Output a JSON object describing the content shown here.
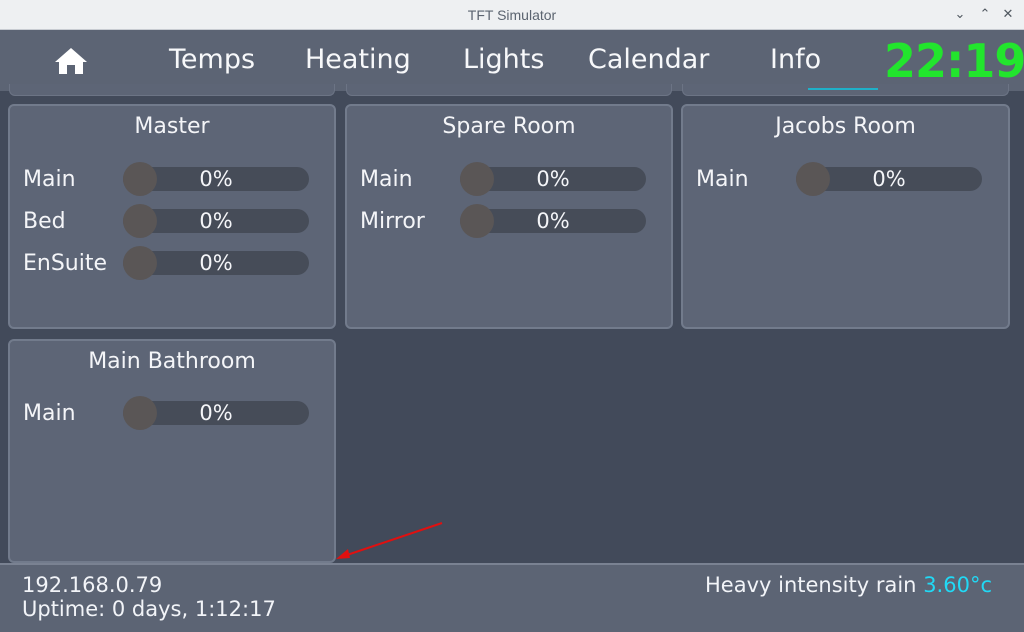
{
  "window": {
    "title": "TFT Simulator"
  },
  "nav": {
    "tabs": [
      {
        "label": "Temps"
      },
      {
        "label": "Heating"
      },
      {
        "label": "Lights"
      },
      {
        "label": "Calendar"
      },
      {
        "label": "Info"
      }
    ],
    "active_tab": "Lights",
    "clock": "22:19"
  },
  "cards": [
    {
      "title": "Master",
      "lights": [
        {
          "label": "Main",
          "value": "0%",
          "level": 0
        },
        {
          "label": "Bed",
          "value": "0%",
          "level": 0
        },
        {
          "label": "EnSuite",
          "value": "0%",
          "level": 0
        }
      ]
    },
    {
      "title": "Spare Room",
      "lights": [
        {
          "label": "Main",
          "value": "0%",
          "level": 0
        },
        {
          "label": "Mirror",
          "value": "0%",
          "level": 0
        }
      ]
    },
    {
      "title": "Jacobs Room",
      "lights": [
        {
          "label": "Main",
          "value": "0%",
          "level": 0
        }
      ]
    },
    {
      "title": "Main Bathroom",
      "lights": [
        {
          "label": "Main",
          "value": "0%",
          "level": 0
        }
      ]
    }
  ],
  "status": {
    "ip": "192.168.0.79",
    "uptime": "Uptime: 0 days, 1:12:17",
    "weather": "Heavy intensity rain",
    "temperature": "3.60°c"
  },
  "colors": {
    "accent": "#1fb0c8",
    "clock": "#22e52d",
    "temperature": "#21d9f5",
    "annotation_arrow": "#e01010"
  }
}
